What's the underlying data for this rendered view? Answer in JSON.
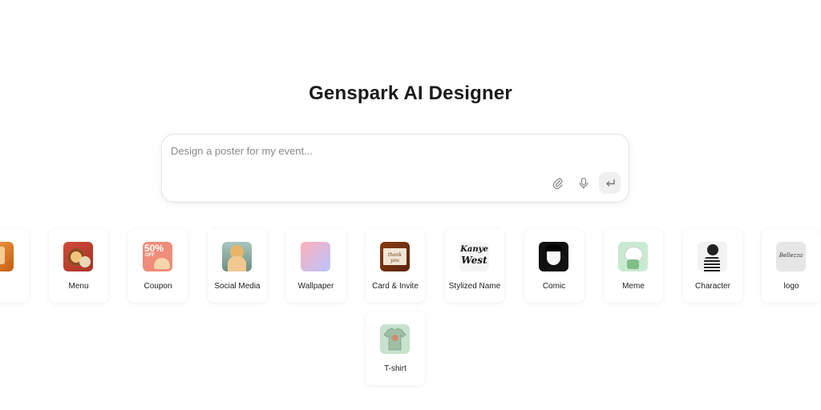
{
  "header": {
    "title": "Genspark AI Designer"
  },
  "prompt": {
    "placeholder": "Design a poster for my event..."
  },
  "tools": {
    "attach_icon": "paperclip-icon",
    "mic_icon": "microphone-icon",
    "send_icon": "enter-arrow-icon"
  },
  "categories": [
    {
      "label": "duct"
    },
    {
      "label": "Menu"
    },
    {
      "label": "Coupon"
    },
    {
      "label": "Social Media"
    },
    {
      "label": "Wallpaper"
    },
    {
      "label": "Card & Invite"
    },
    {
      "label": "Stylized Name"
    },
    {
      "label": "Comic"
    },
    {
      "label": "Meme"
    },
    {
      "label": "Character"
    },
    {
      "label": "logo"
    },
    {
      "label": "T-shirt"
    }
  ],
  "thumb_text": {
    "coupon": "50%",
    "coupon_sub": "OFF",
    "card": "thank you",
    "stylized_1": "Kanye",
    "stylized_2": "West",
    "logo": "Bellezza"
  }
}
